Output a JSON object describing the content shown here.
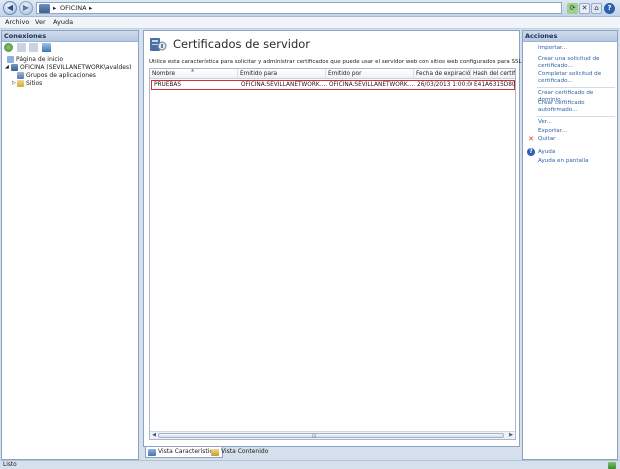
{
  "address": {
    "breadcrumb": [
      "OFICINA"
    ],
    "separator": "▸"
  },
  "menu": [
    "Archivo",
    "Ver",
    "Ayuda"
  ],
  "connections": {
    "title": "Conexiones",
    "tree": [
      {
        "label": "Página de inicio",
        "level": 1,
        "icon": "home-page-icon"
      },
      {
        "label": "OFICINA (SEVILLANETWORK\\avaldes)",
        "level": 1,
        "icon": "server-icon",
        "expanded": true
      },
      {
        "label": "Grupos de aplicaciones",
        "level": 2,
        "icon": "app-pools-icon"
      },
      {
        "label": "Sitios",
        "level": 2,
        "icon": "sites-folder-icon",
        "expandable": true
      }
    ]
  },
  "main": {
    "title": "Certificados de servidor",
    "description": "Utilice esta característica para solicitar y administrar certificados que puede usar el servidor web con sitios web configurados para SSL.",
    "columns": [
      "Nombre",
      "Emitido para",
      "Emitido por",
      "Fecha de expiración",
      "Hash del certific"
    ],
    "rows": [
      {
        "name": "PRUEBAS",
        "issued_to": "OFICINA.SEVILLANETWORK....",
        "issued_by": "OFICINA.SEVILLANETWORK....",
        "expires": "26/03/2013 1:00:00",
        "hash": "E41A6315D8052"
      }
    ]
  },
  "view_tabs": {
    "features": "Vista Características",
    "content": "Vista Contenido"
  },
  "actions": {
    "title": "Acciones",
    "items": [
      {
        "label": "Importar...",
        "type": "link"
      },
      {
        "label": "Crear una solicitud de certificado...",
        "type": "link"
      },
      {
        "label": "Completar solicitud de certificado...",
        "type": "link"
      },
      {
        "label": "Crear certificado de dominio...",
        "type": "link"
      },
      {
        "label": "Crear certificado autofirmado...",
        "type": "link"
      },
      {
        "label": "Ver...",
        "type": "link"
      },
      {
        "label": "Exportar...",
        "type": "link"
      },
      {
        "label": "Quitar",
        "type": "link"
      },
      {
        "label": "Ayuda",
        "type": "link"
      },
      {
        "label": "Ayuda en pantalla",
        "type": "link"
      }
    ]
  },
  "status": "Listo",
  "colors": {
    "accent_link": "#2c5fa8",
    "selection_border": "#d63030",
    "pane_border": "#8ca3c4",
    "remove_icon": "#d62b2b",
    "help_icon": "#2d5fb0"
  }
}
